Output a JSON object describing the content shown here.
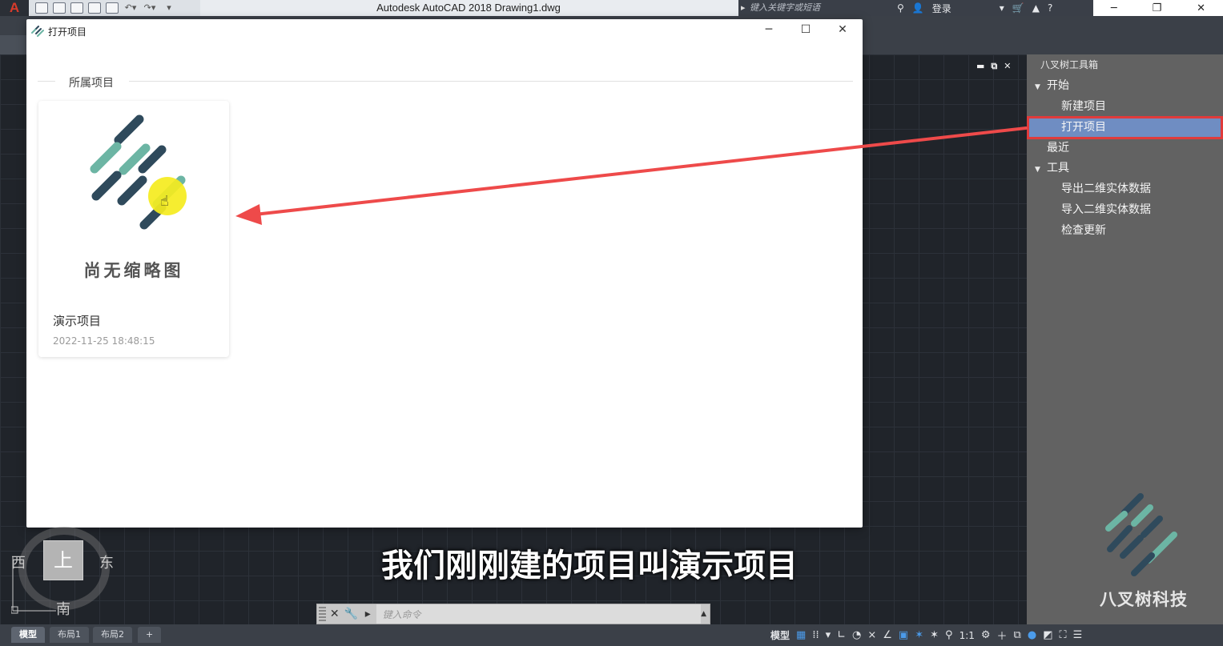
{
  "app": {
    "title": "Autodesk AutoCAD 2018    Drawing1.dwg",
    "logo_letter": "A",
    "search_placeholder": "键入关键字或短语",
    "login_label": "登录"
  },
  "window_controls": {
    "minimize": "─",
    "restore": "❐",
    "close": "✕"
  },
  "dialog": {
    "title": "打开项目",
    "section_label": "所属项目",
    "controls": {
      "minimize": "─",
      "maximize": "☐",
      "close": "✕"
    },
    "cards": [
      {
        "thumbnail_label": "尚无缩略图",
        "name": "演示项目",
        "date": "2022-11-25 18:48:15"
      }
    ]
  },
  "side_panel": {
    "title": "八叉树工具箱",
    "tree": [
      {
        "label": "开始",
        "level": 0,
        "expanded": true
      },
      {
        "label": "新建项目",
        "level": 1
      },
      {
        "label": "打开项目",
        "level": 1,
        "selected": true
      },
      {
        "label": "最近",
        "level": 0
      },
      {
        "label": "工具",
        "level": 0,
        "expanded": true
      },
      {
        "label": "导出二维实体数据",
        "level": 1
      },
      {
        "label": "导入二维实体数据",
        "level": 1
      },
      {
        "label": "检查更新",
        "level": 1
      }
    ],
    "brand_name": "八叉树科技"
  },
  "canvas_controls": {
    "minimize": "▬",
    "restore": "⧉",
    "close": "✕"
  },
  "viewcube": {
    "top": "上",
    "west": "西",
    "east": "东",
    "south": "南"
  },
  "subtitle": "我们刚刚建的项目叫演示项目",
  "command_line": {
    "placeholder": "键入命令"
  },
  "status_bar": {
    "tabs": [
      {
        "label": "模型",
        "active": true
      },
      {
        "label": "布局1"
      },
      {
        "label": "布局2"
      }
    ],
    "add_tab": "+",
    "model_label": "模型",
    "scale": "1:1"
  },
  "colors": {
    "accent_red": "#e03b3b",
    "selected_row": "#6f8dc2",
    "logo_dark": "#2f4a5c",
    "logo_teal": "#6cb5a4",
    "cursor_highlight": "#f5ec1e"
  }
}
